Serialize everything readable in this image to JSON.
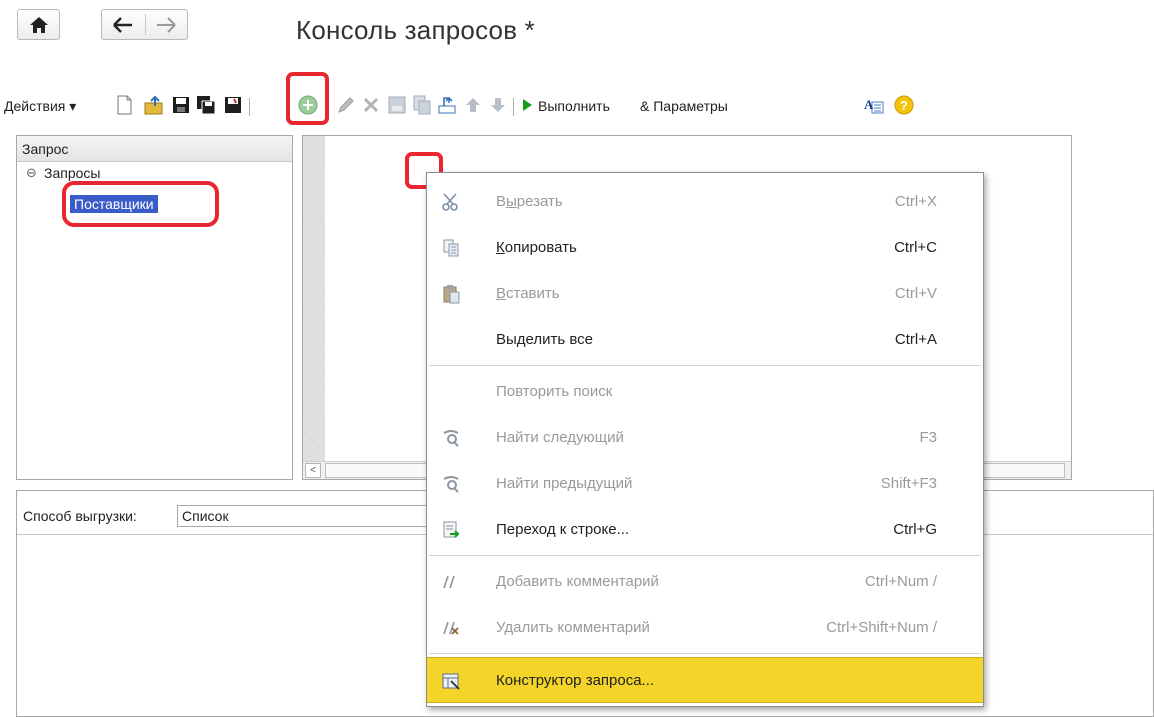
{
  "window": {
    "title": "Консоль запросов *"
  },
  "toolbar": {
    "actions_label": "Действия ▾",
    "run_label": "Выполнить",
    "params_prefix": "& ",
    "params_label": "Параметры"
  },
  "tree": {
    "header": "Запрос",
    "root_label": "Запросы",
    "root_toggle": "⊖",
    "child_label": "Поставщики"
  },
  "bottom": {
    "export_label": "Способ выгрузки:",
    "export_value": "Список"
  },
  "context_menu": {
    "items": [
      {
        "label_pre": "В",
        "label_u": "ы",
        "label_post": "резать",
        "shortcut": "Ctrl+X",
        "enabled": false,
        "icon": "scissors-icon"
      },
      {
        "label_pre": "",
        "label_u": "К",
        "label_post": "опировать",
        "shortcut": "Ctrl+C",
        "enabled": true,
        "icon": "copy-icon"
      },
      {
        "label_pre": "",
        "label_u": "В",
        "label_post": "ставить",
        "shortcut": "Ctrl+V",
        "enabled": false,
        "icon": "paste-icon"
      },
      {
        "label_pre": "Выделить все",
        "label_u": "",
        "label_post": "",
        "shortcut": "Ctrl+A",
        "enabled": true,
        "icon": ""
      },
      {
        "label_pre": "Повторить поиск",
        "label_u": "",
        "label_post": "",
        "shortcut": "",
        "enabled": false,
        "icon": ""
      },
      {
        "label_pre": "Найти следующий",
        "label_u": "",
        "label_post": "",
        "shortcut": "F3",
        "enabled": false,
        "icon": "find-next-icon"
      },
      {
        "label_pre": "Найти предыдущий",
        "label_u": "",
        "label_post": "",
        "shortcut": "Shift+F3",
        "enabled": false,
        "icon": "find-prev-icon"
      },
      {
        "label_pre": "Переход к строке...",
        "label_u": "",
        "label_post": "",
        "shortcut": "Ctrl+G",
        "enabled": true,
        "icon": "goto-line-icon"
      },
      {
        "label_pre": "Добавить комментарий",
        "label_u": "",
        "label_post": "",
        "shortcut": "Ctrl+Num /",
        "enabled": false,
        "icon": "add-comment-icon"
      },
      {
        "label_pre": "Удалить комментарий",
        "label_u": "",
        "label_post": "",
        "shortcut": "Ctrl+Shift+Num /",
        "enabled": false,
        "icon": "remove-comment-icon"
      },
      {
        "label_pre": "Конструктор запроса...",
        "label_u": "",
        "label_post": "",
        "shortcut": "",
        "enabled": true,
        "highlighted": true,
        "icon": "query-builder-icon"
      }
    ]
  },
  "colors": {
    "highlight": "#f4d428",
    "selection": "#3a5cc9",
    "annotation": "#e8262f",
    "run_green": "#1a9a1a"
  }
}
